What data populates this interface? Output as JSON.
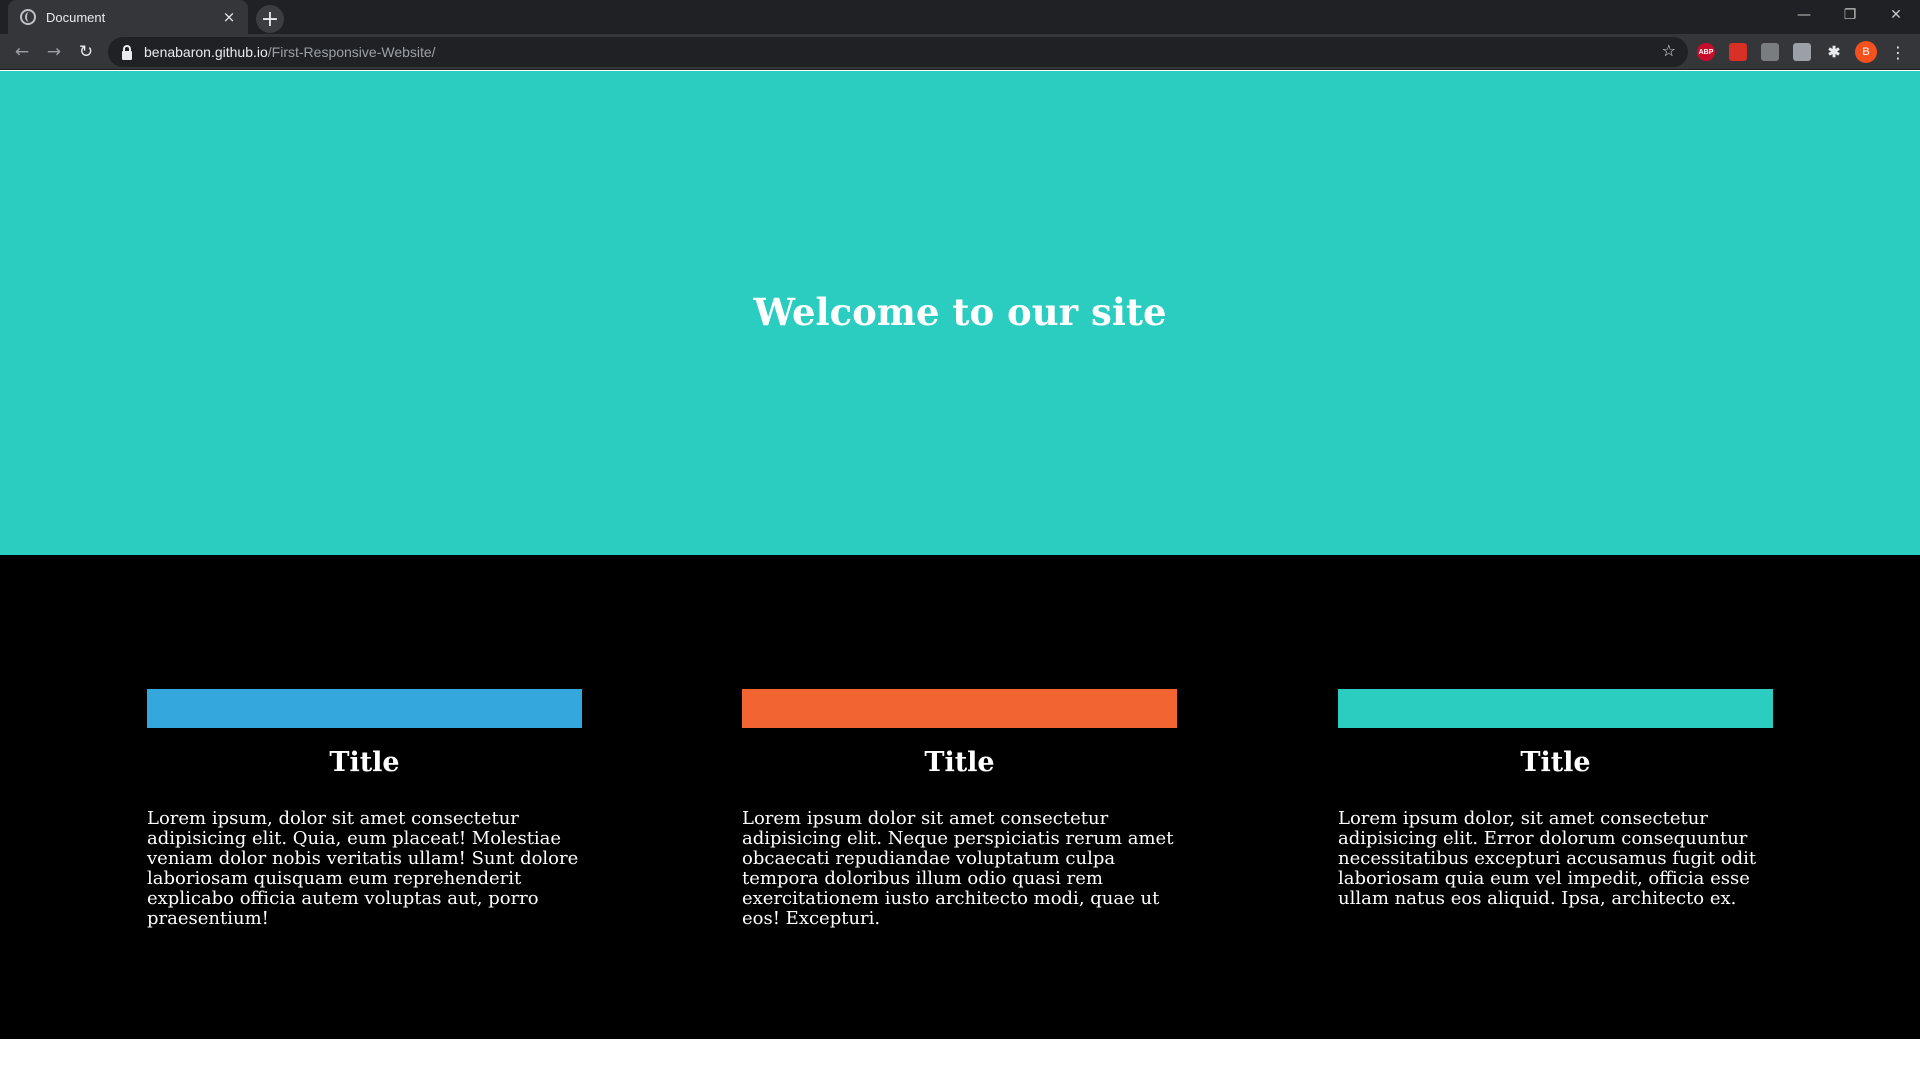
{
  "browser": {
    "tab": {
      "title": "Document",
      "close_glyph": "×",
      "favicon": "globe-icon"
    },
    "new_tab_glyph": "+",
    "window_controls": {
      "minimize": "—",
      "maximize": "❐",
      "close": "✕"
    },
    "nav": {
      "back": "←",
      "forward": "→",
      "reload": "↻"
    },
    "address": {
      "host": "benabaron.github.io",
      "path": "/First-Responsive-Website/"
    },
    "star_glyph": "☆",
    "extensions": [
      {
        "name": "abp-icon",
        "label": "ABP"
      },
      {
        "name": "extension-red-icon",
        "label": ""
      },
      {
        "name": "extension-grey-icon",
        "label": ""
      },
      {
        "name": "extension-text-icon",
        "label": ""
      },
      {
        "name": "puzzle-icon",
        "label": "✱"
      }
    ],
    "profile_initial": "B",
    "menu_glyph": "⋮"
  },
  "hero": {
    "heading": "Welcome to our site",
    "background": "#2bcdc1"
  },
  "features": {
    "background": "#000000",
    "cards": [
      {
        "accent": "#34a7dc",
        "title": "Title",
        "body": "Lorem ipsum, dolor sit amet consectetur adipisicing elit. Quia, eum placeat! Molestiae veniam dolor nobis veritatis ullam! Sunt dolore laboriosam quisquam eum reprehenderit explicabo officia autem voluptas aut, porro praesentium!"
      },
      {
        "accent": "#f26530",
        "title": "Title",
        "body": "Lorem ipsum dolor sit amet consectetur adipisicing elit. Neque perspiciatis rerum amet obcaecati repudiandae voluptatum culpa tempora doloribus illum odio quasi rem exercitationem iusto architecto modi, quae ut eos! Excepturi."
      },
      {
        "accent": "#2bcdc1",
        "title": "Title",
        "body": "Lorem ipsum dolor, sit amet consectetur adipisicing elit. Error dolorum consequuntur necessitatibus excepturi accusamus fugit odit laboriosam quia eum vel impedit, officia esse ullam natus eos aliquid. Ipsa, architecto ex."
      }
    ]
  }
}
